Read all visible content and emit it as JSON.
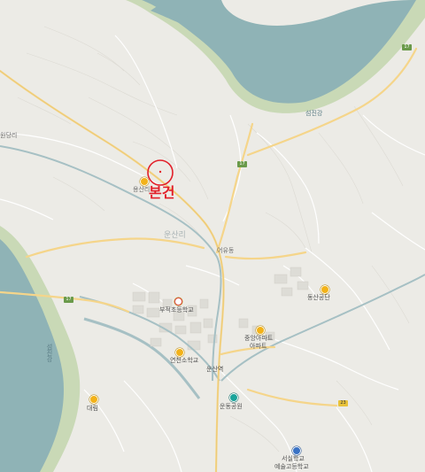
{
  "map": {
    "highlight": {
      "label": "본건",
      "color": "#e2202a"
    },
    "labels": {
      "river_east": "섬진강",
      "river_west": "섬진강",
      "town_nw": "용산리",
      "area_center": "운산리",
      "village_mid": "어유동",
      "west_edge": "원당리",
      "office": "부적초등학교",
      "school": "연천소학교",
      "station": "운산역",
      "complex": "중앙아파트",
      "complex_sub": "아파트",
      "industrial": "동산공단",
      "park": "운동공원",
      "south_west": "대림",
      "bottom_poi": "서실학교",
      "bottom_poi_sub": "예술고등학교"
    },
    "road_shields": {
      "north": "17",
      "center": "17",
      "west": "17",
      "east": "23"
    },
    "colors": {
      "land": "#ecebe6",
      "water": "#8fb3b6",
      "riverbank": "#c9d9b6",
      "road_main": "#f5d58a",
      "road_minor": "#ffffff",
      "rail": "#a6c0c4"
    }
  }
}
